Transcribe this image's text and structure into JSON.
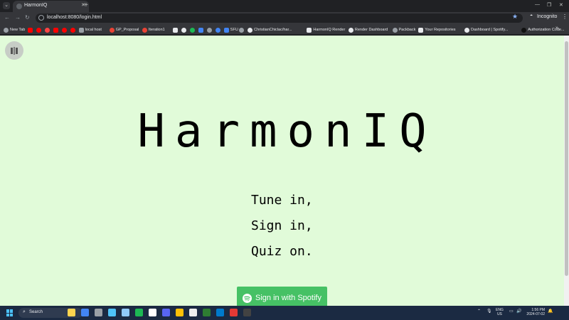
{
  "browser": {
    "tab_title": "HarmonIQ",
    "url": "localhost:8080/login.html",
    "profile_label": "Incognito",
    "bookmarks": [
      {
        "label": "New Tab",
        "color": "#9aa0a6"
      },
      {
        "label": "",
        "color": "#ff0000"
      },
      {
        "label": "",
        "color": "#ff0000"
      },
      {
        "label": "",
        "color": "#ff4444"
      },
      {
        "label": "",
        "color": "#ff0000"
      },
      {
        "label": "",
        "color": "#ff0000"
      },
      {
        "label": "",
        "color": "#ff0000"
      },
      {
        "label": "local host",
        "color": "#9aa0a6"
      },
      {
        "label": "GP_Proposal",
        "color": "#ea4335"
      },
      {
        "label": "Iteration1",
        "color": "#ea4335"
      },
      {
        "label": "",
        "color": "#e8eaed"
      },
      {
        "label": "",
        "color": "#e8eaed"
      },
      {
        "label": "",
        "color": "#1db954"
      },
      {
        "label": "",
        "color": "#4285f4"
      },
      {
        "label": "",
        "color": "#9aa0a6"
      },
      {
        "label": "",
        "color": "#4285f4"
      },
      {
        "label": "SFU",
        "color": "#4285f4"
      },
      {
        "label": "",
        "color": "#9aa0a6"
      },
      {
        "label": "ChristianChiclac/har...",
        "color": "#e8eaed"
      },
      {
        "label": "HarmonIQ Render",
        "color": "#e8eaed"
      },
      {
        "label": "Render Dashboard",
        "color": "#e8eaed"
      },
      {
        "label": "Packback",
        "color": "#9aa0a6"
      },
      {
        "label": "Your Repositories",
        "color": "#e8eaed"
      },
      {
        "label": "Dashboard | Spotify...",
        "color": "#e8eaed"
      },
      {
        "label": "Authorization Code...",
        "color": "#111111"
      }
    ]
  },
  "page": {
    "title": "HarmonIQ",
    "taglines": [
      "Tune in,",
      "Sign in,",
      "Quiz on."
    ],
    "signin_label": "Sign in with Spotify",
    "colors": {
      "background": "#e1fbd9",
      "button": "#46c165"
    }
  },
  "taskbar": {
    "search_label": "Search",
    "lang_line1": "ENG",
    "lang_line2": "US",
    "time": "1:56 PM",
    "date": "2024-07-02",
    "apps": [
      "#ffd54f",
      "#4285f4",
      "#9aa0a6",
      "#4fc3f7",
      "#90caf9",
      "#1db954",
      "#ffffff",
      "#5865f2",
      "#ffc107",
      "#eeeeee",
      "#2e7d32",
      "#007acc",
      "#e53935",
      "#424242"
    ]
  }
}
